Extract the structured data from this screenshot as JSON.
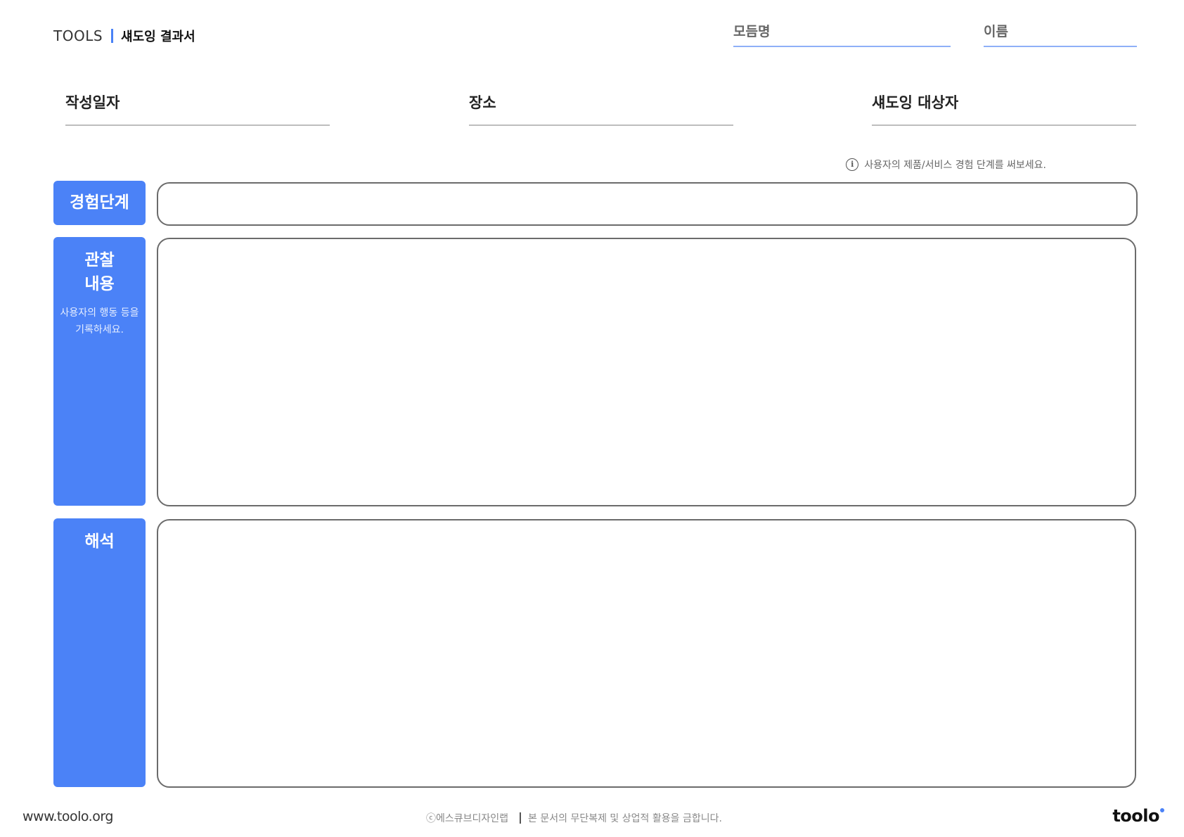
{
  "header": {
    "brand": "TOOLS",
    "doc_title": "섀도잉 결과서",
    "module_label": "모듬명",
    "name_label": "이름"
  },
  "fields": {
    "date_label": "작성일자",
    "place_label": "장소",
    "target_label": "섀도잉 대상자"
  },
  "hint": "사용자의 제품/서비스 경험 단계를 써보세요.",
  "sections": {
    "stage": {
      "title": "경험단계"
    },
    "observation": {
      "title": "관찰\n내용",
      "subtitle": "사용자의 행동 등을\n기록하세요."
    },
    "interpretation": {
      "title": "해석"
    }
  },
  "footer": {
    "url": "www.toolo.org",
    "copyright": "ⓒ에스큐브디자인랩",
    "notice": "본 문서의 무단복제 및 상업적 활용을 금합니다.",
    "logo": "toolo"
  },
  "colors": {
    "accent": "#4b82f7",
    "box_border": "#6b6b6b"
  }
}
